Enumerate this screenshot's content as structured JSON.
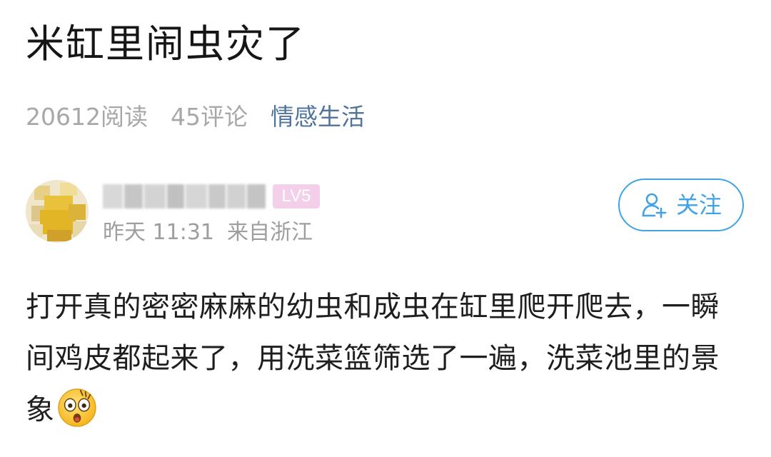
{
  "post": {
    "title": "米缸里闹虫灾了",
    "read_count": "20612阅读",
    "comment_count": "45评论",
    "category": "情感生活",
    "body": "打开真的密密麻麻的幼虫和成虫在缸里爬开爬去，一瞬间鸡皮都起来了，用洗菜篮筛选了一遍，洗菜池里的景象"
  },
  "author": {
    "level": "LV5",
    "time": "昨天 11:31",
    "location": "来自浙江",
    "follow_label": "关注"
  },
  "icons": {
    "follow": "add-user-icon",
    "emoji": "shocked-face-emoji-icon"
  },
  "colors": {
    "category": "#51749b",
    "follow_accent": "#3fa3e6",
    "level_badge": "#f4cfe9",
    "meta_gray": "#a8a8a8"
  }
}
